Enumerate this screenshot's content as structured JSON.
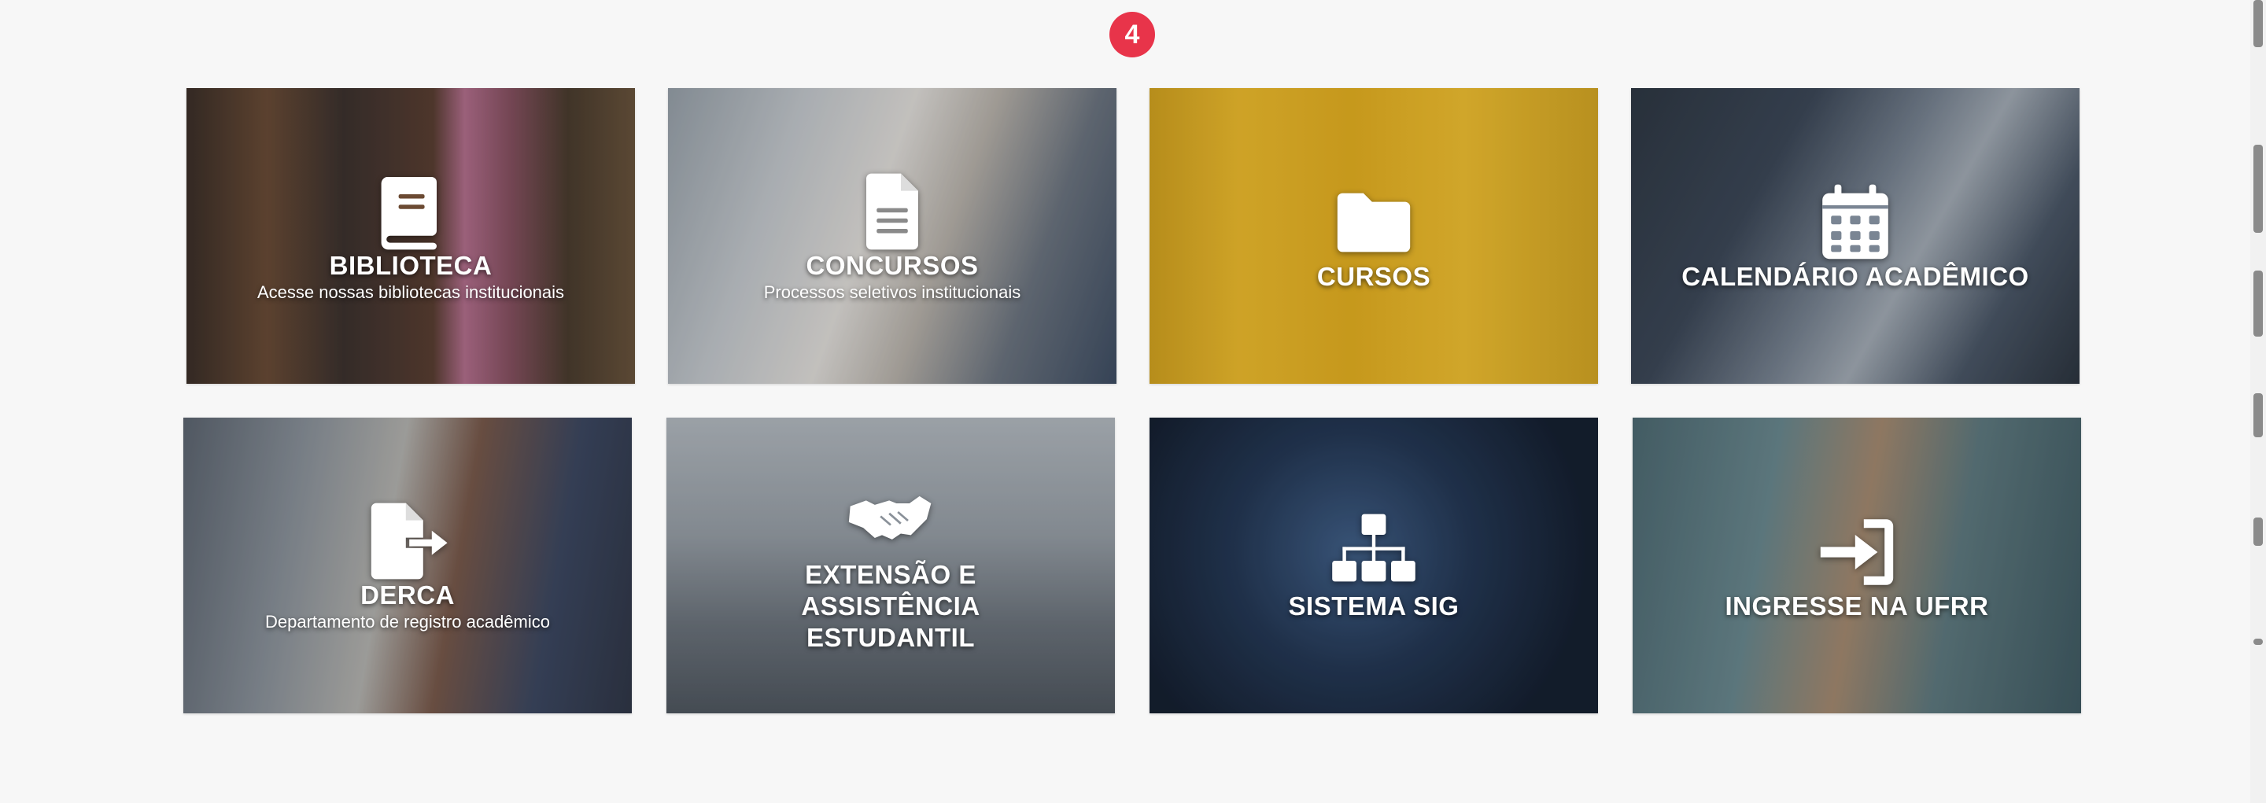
{
  "notification_badge": "4",
  "cards": [
    {
      "title": "BIBLIOTECA",
      "subtitle": "Acesse nossas bibliotecas institucionais",
      "icon": "book-icon"
    },
    {
      "title": "CONCURSOS",
      "subtitle": "Processos seletivos institucionais",
      "icon": "document-icon"
    },
    {
      "title": "CURSOS",
      "subtitle": "",
      "icon": "folder-icon"
    },
    {
      "title": "CALENDÁRIO ACADÊMICO",
      "subtitle": "",
      "icon": "calendar-icon"
    },
    {
      "title": "DERCA",
      "subtitle": "Departamento de registro acadêmico",
      "icon": "file-export-icon"
    },
    {
      "title": "EXTENSÃO E ASSISTÊNCIA ESTUDANTIL",
      "subtitle": "",
      "icon": "handshake-icon"
    },
    {
      "title": "SISTEMA SIG",
      "subtitle": "",
      "icon": "network-icon"
    },
    {
      "title": "INGRESSE NA UFRR",
      "subtitle": "",
      "icon": "sign-in-icon"
    }
  ],
  "colors": {
    "badge": "#e8344a",
    "page_background": "#f7f7f7"
  }
}
